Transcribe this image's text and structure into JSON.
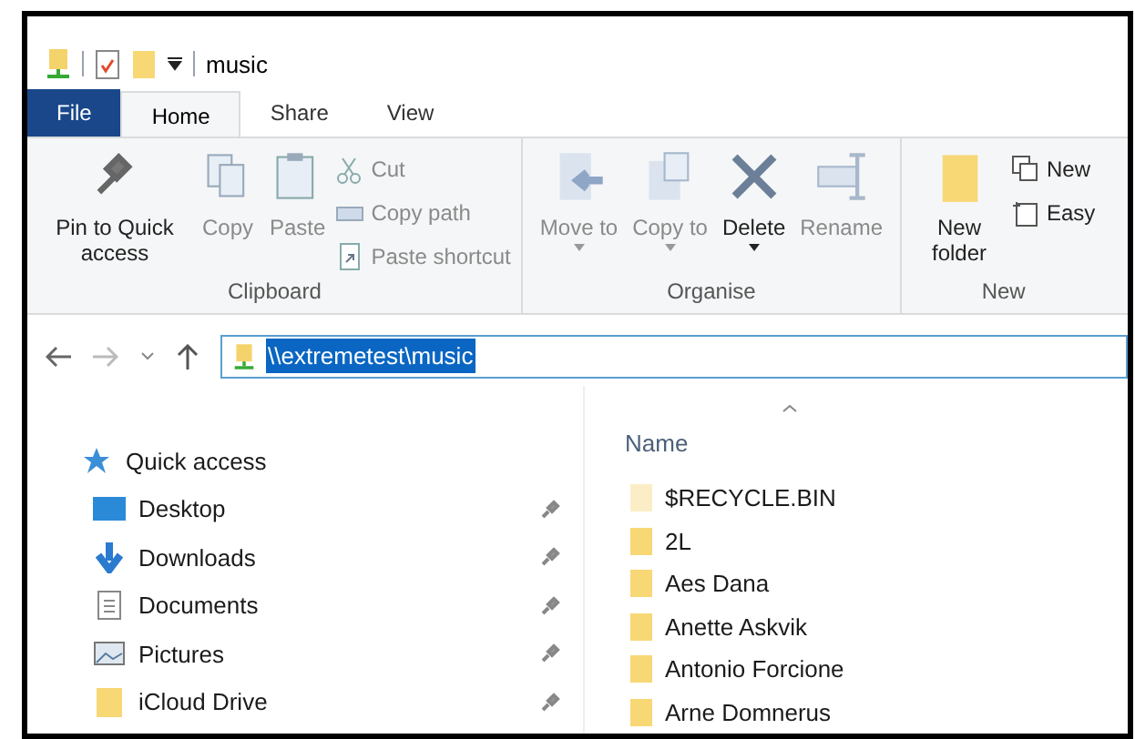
{
  "window": {
    "title": "music"
  },
  "tabs": [
    {
      "label": "File",
      "kind": "file",
      "selected": false
    },
    {
      "label": "Home",
      "kind": "tab",
      "selected": true
    },
    {
      "label": "Share",
      "kind": "tab",
      "selected": false
    },
    {
      "label": "View",
      "kind": "tab",
      "selected": false
    }
  ],
  "ribbon": {
    "groups": [
      {
        "label": "Clipboard",
        "items": [
          {
            "kind": "large",
            "label": "Pin to Quick access",
            "disabled": false
          },
          {
            "kind": "large",
            "label": "Copy",
            "disabled": true
          },
          {
            "kind": "large",
            "label": "Paste",
            "disabled": true
          },
          {
            "kind": "small",
            "label": "Cut",
            "disabled": true
          },
          {
            "kind": "small",
            "label": "Copy path",
            "disabled": true
          },
          {
            "kind": "small",
            "label": "Paste shortcut",
            "disabled": true
          }
        ]
      },
      {
        "label": "Organise",
        "items": [
          {
            "kind": "large",
            "label": "Move to",
            "dropdown": true,
            "disabled": true
          },
          {
            "kind": "large",
            "label": "Copy to",
            "dropdown": true,
            "disabled": true
          },
          {
            "kind": "large",
            "label": "Delete",
            "dropdown": true,
            "disabled": false
          },
          {
            "kind": "large",
            "label": "Rename",
            "disabled": true
          }
        ]
      },
      {
        "label": "New",
        "items": [
          {
            "kind": "large",
            "label": "New folder",
            "disabled": false
          },
          {
            "kind": "small",
            "label": "New",
            "disabled": false
          },
          {
            "kind": "small",
            "label": "Easy",
            "disabled": false
          }
        ]
      }
    ]
  },
  "address_bar": {
    "path": "\\\\extremetest\\music",
    "selected": true
  },
  "navigation_pane": [
    {
      "label": "Quick access",
      "pinned": false
    },
    {
      "label": "Desktop",
      "pinned": true
    },
    {
      "label": "Downloads",
      "pinned": true
    },
    {
      "label": "Documents",
      "pinned": true
    },
    {
      "label": "Pictures",
      "pinned": true
    },
    {
      "label": "iCloud Drive",
      "pinned": true
    }
  ],
  "file_list": {
    "columns": [
      "Name"
    ],
    "rows": [
      {
        "name": "$RECYCLE.BIN",
        "hidden": true
      },
      {
        "name": "2L",
        "hidden": false
      },
      {
        "name": "Aes Dana",
        "hidden": false
      },
      {
        "name": "Anette Askvik",
        "hidden": false
      },
      {
        "name": "Antonio Forcione",
        "hidden": false
      },
      {
        "name": "Arne Domnerus",
        "hidden": false
      }
    ]
  }
}
